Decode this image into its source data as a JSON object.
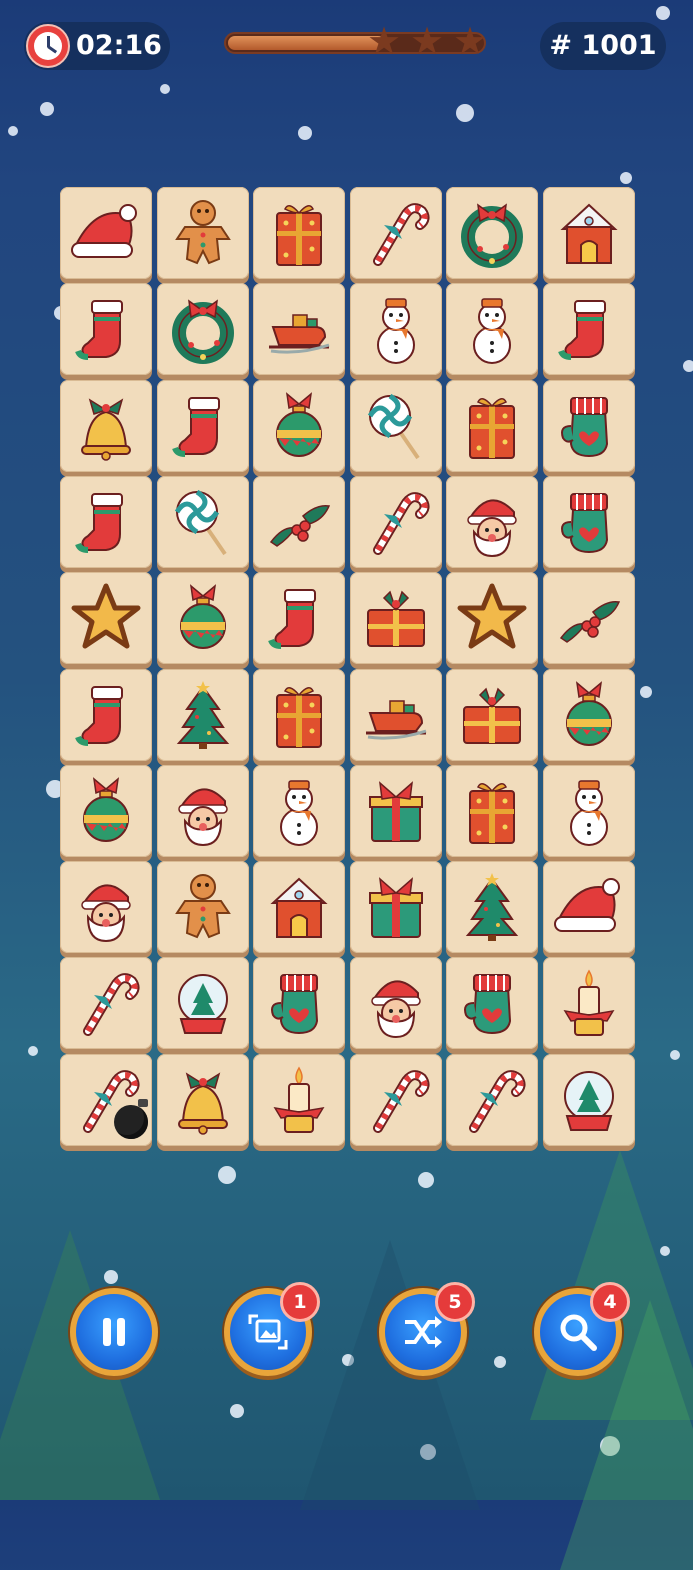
{
  "hud": {
    "timer": "02:16",
    "level": "# 1001",
    "progress_fraction": 0.62,
    "stars_earned": 0,
    "stars_total": 3
  },
  "board": {
    "rows": 10,
    "cols": 6,
    "tiles": [
      [
        "santa-hat",
        "gingerbread-man",
        "gift-box",
        "candy-cane",
        "wreath",
        "gingerbread-house"
      ],
      [
        "stocking",
        "wreath",
        "sleigh",
        "snowman",
        "snowman",
        "stocking"
      ],
      [
        "bell",
        "stocking",
        "ornament",
        "lollipop",
        "gift-box",
        "mitten"
      ],
      [
        "stocking",
        "lollipop",
        "holly",
        "candy-cane",
        "santa",
        "mitten"
      ],
      [
        "cookie-star",
        "ornament",
        "stocking",
        "gift-wrapped",
        "cookie-star",
        "holly"
      ],
      [
        "stocking",
        "christmas-tree",
        "gift-box",
        "sleigh",
        "gift-wrapped",
        "ornament"
      ],
      [
        "ornament",
        "santa",
        "snowman",
        "gift-green",
        "gift-box",
        "snowman"
      ],
      [
        "santa",
        "gingerbread-man",
        "gingerbread-house",
        "gift-green",
        "christmas-tree",
        "santa-hat"
      ],
      [
        "candy-cane",
        "snow-globe",
        "mitten",
        "santa",
        "mitten",
        "candle"
      ],
      [
        "candy-cane",
        "bell",
        "candle",
        "candy-cane",
        "candy-cane",
        "snow-globe"
      ]
    ],
    "bomb_tile": {
      "row": 9,
      "col": 0
    }
  },
  "controls": [
    {
      "name": "pause-button",
      "icon": "pause-icon",
      "badge": ""
    },
    {
      "name": "hint-image-button",
      "icon": "image-icon",
      "badge": "1"
    },
    {
      "name": "shuffle-button",
      "icon": "shuffle-icon",
      "badge": "5"
    },
    {
      "name": "search-button",
      "icon": "search-icon",
      "badge": "4"
    }
  ],
  "colors": {
    "tile": "#f1dcbc",
    "button": "#1f6fe0",
    "button_ring": "#e9a53a",
    "badge": "#e53b3b"
  }
}
